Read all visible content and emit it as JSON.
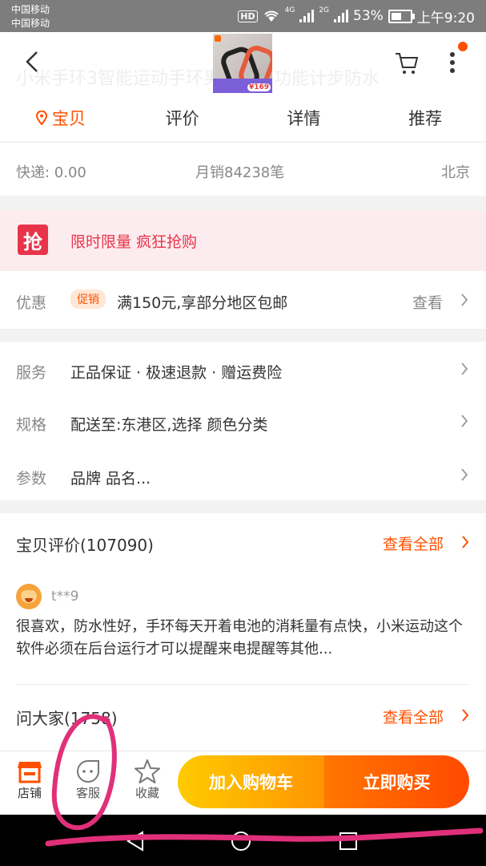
{
  "status_bar": {
    "carrier_1": "中国移动",
    "carrier_2": "中国移动",
    "hd": "HD",
    "net_4g": "4G",
    "net_2g": "2G",
    "battery": "53%",
    "time": "上午9:20"
  },
  "header": {
    "ghost_text": "小米手环3智能运动手环男女款多功能计步防水",
    "thumb_price": "¥169",
    "tabs": [
      {
        "label": "宝贝"
      },
      {
        "label": "评价"
      },
      {
        "label": "详情"
      },
      {
        "label": "推荐"
      }
    ]
  },
  "shipping": {
    "fee": "快递: 0.00",
    "monthly_sales": "月销84238笔",
    "location": "北京"
  },
  "flash_sale": {
    "badge": "抢",
    "text": "限时限量 疯狂抢购"
  },
  "promotion": {
    "label": "优惠",
    "tag": "促销",
    "text": "满150元,享部分地区包邮",
    "link": "查看"
  },
  "details": [
    {
      "label": "服务",
      "text": "正品保证 · 极速退款 · 赠运费险"
    },
    {
      "label": "规格",
      "text": "配送至:东港区,选择 颜色分类"
    },
    {
      "label": "参数",
      "text": "品牌 品名..."
    }
  ],
  "reviews": {
    "title": "宝贝评价(107090)",
    "view_all": "查看全部",
    "user": "t**9",
    "content": "很喜欢，防水性好，手环每天开着电池的消耗量有点快，小米运动这个软件必须在后台运行才可以提醒来电提醒等其他..."
  },
  "qa": {
    "title": "问大家(1758)",
    "view_all": "查看全部"
  },
  "bottom_bar": {
    "shop": "店铺",
    "service": "客服",
    "favorite": "收藏",
    "add_to_cart": "加入购物车",
    "buy_now": "立即购买"
  },
  "colors": {
    "accent": "#ff5000",
    "flash": "#e8344a"
  }
}
